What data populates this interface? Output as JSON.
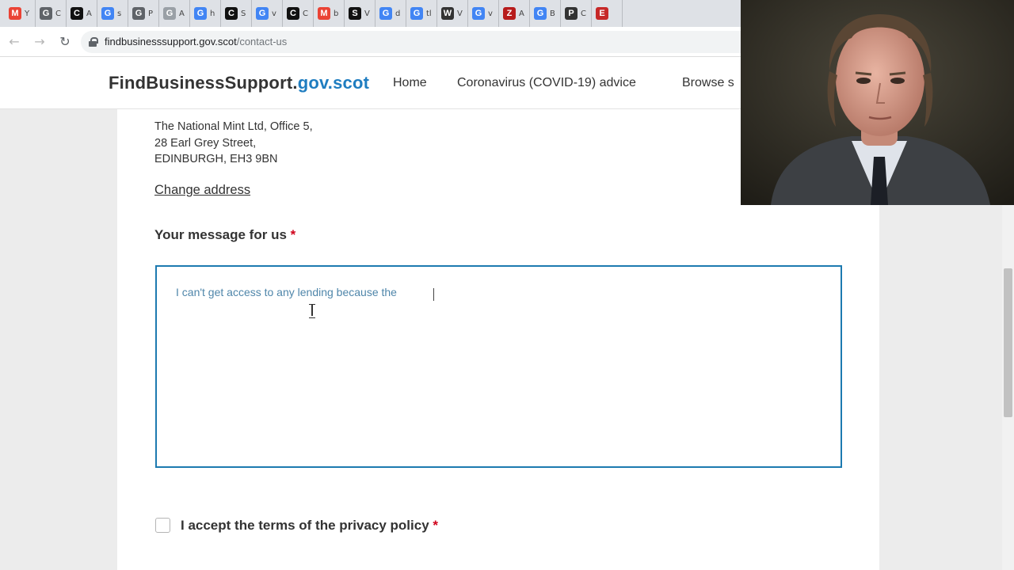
{
  "browser": {
    "tabs": [
      {
        "letter": "M",
        "title": "Y",
        "color": "#ea4335"
      },
      {
        "letter": "G",
        "title": "C",
        "color": "#5f6368"
      },
      {
        "letter": "C",
        "title": "A",
        "color": "#111111"
      },
      {
        "letter": "G",
        "title": "s",
        "color": "#4285f4"
      },
      {
        "letter": "G",
        "title": "P",
        "color": "#5f6368"
      },
      {
        "letter": "G",
        "title": "A",
        "color": "#9aa0a6"
      },
      {
        "letter": "G",
        "title": "h",
        "color": "#4285f4"
      },
      {
        "letter": "C",
        "title": "S",
        "color": "#111111"
      },
      {
        "letter": "G",
        "title": "v",
        "color": "#4285f4"
      },
      {
        "letter": "C",
        "title": "C",
        "color": "#111111"
      },
      {
        "letter": "M",
        "title": "b",
        "color": "#ea4335"
      },
      {
        "letter": "S",
        "title": "V",
        "color": "#111111"
      },
      {
        "letter": "G",
        "title": "d",
        "color": "#4285f4"
      },
      {
        "letter": "G",
        "title": "tl",
        "color": "#4285f4"
      },
      {
        "letter": "W",
        "title": "V",
        "color": "#333333"
      },
      {
        "letter": "G",
        "title": "v",
        "color": "#4285f4"
      },
      {
        "letter": "Z",
        "title": "A",
        "color": "#b71c1c"
      },
      {
        "letter": "G",
        "title": "B",
        "color": "#4285f4"
      },
      {
        "letter": "P",
        "title": "C",
        "color": "#333333"
      },
      {
        "letter": "E",
        "title": "",
        "color": "#c62828"
      }
    ],
    "back_icon": "←",
    "forward_icon": "→",
    "reload_icon": "↻",
    "url_host": "findbusinesssupport.gov.scot",
    "url_path": "/contact-us"
  },
  "site": {
    "logo_main": "FindBusinessSupport.",
    "logo_domain": "gov.scot",
    "accent_color": "#1f7dc0",
    "nav": [
      {
        "label": "Home"
      },
      {
        "label": "Coronavirus (COVID-19) advice"
      },
      {
        "label": "Browse s"
      }
    ]
  },
  "form": {
    "address_lines": [
      "The National Mint Ltd, Office 5,",
      "28 Earl Grey Street,",
      "EDINBURGH, EH3 9BN"
    ],
    "change_address": "Change address",
    "message_label": "Your message for us",
    "required_mark": "*",
    "message_value": "I can't get access to any lending because the ",
    "privacy_label": "I accept the terms of the privacy policy",
    "privacy_checked": false
  }
}
